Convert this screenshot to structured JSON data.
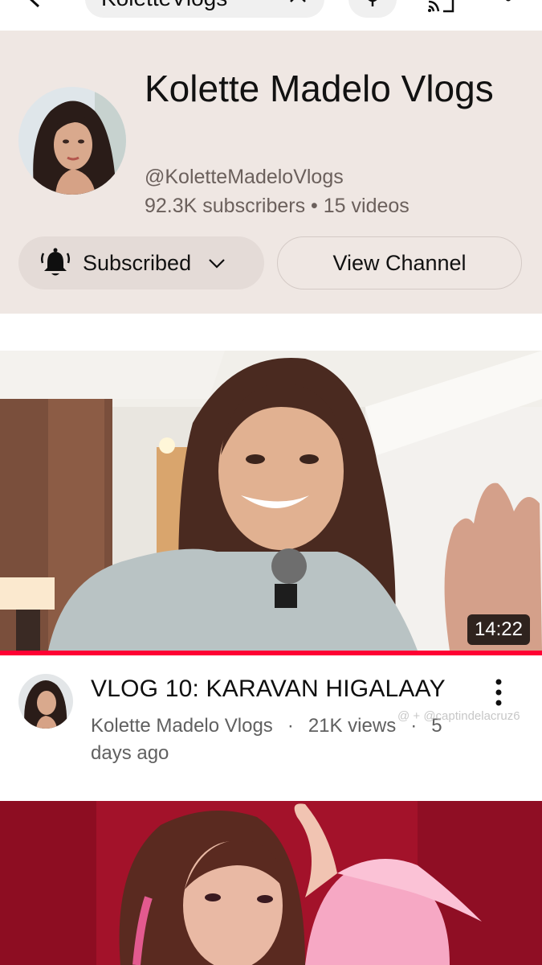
{
  "search": {
    "query": "KoletteVlogs"
  },
  "channel": {
    "name": "Kolette Madelo Vlogs",
    "handle": "@KoletteMadeloVlogs",
    "subscribers": "92.3K subscribers",
    "videos": "15 videos",
    "stats_separator": " • ",
    "subscribed_label": "Subscribed",
    "view_channel_label": "View Channel"
  },
  "videos": [
    {
      "title": "VLOG 10: KARAVAN HIGALAAY",
      "channel": "Kolette Madelo Vlogs",
      "views": "21K views",
      "age": "5 days ago",
      "duration": "14:22",
      "watched_fraction": 1.0
    }
  ],
  "watermark": "@ + @captindelacruz6",
  "colors": {
    "header_bg": "#efe7e3",
    "progress": "#ff0033",
    "subscribe_btn_bg": "#e4dbd7"
  },
  "icons": [
    "back-arrow-icon",
    "clear-icon",
    "microphone-icon",
    "cast-icon",
    "more-vert-icon",
    "bell-icon",
    "chevron-down-icon"
  ]
}
